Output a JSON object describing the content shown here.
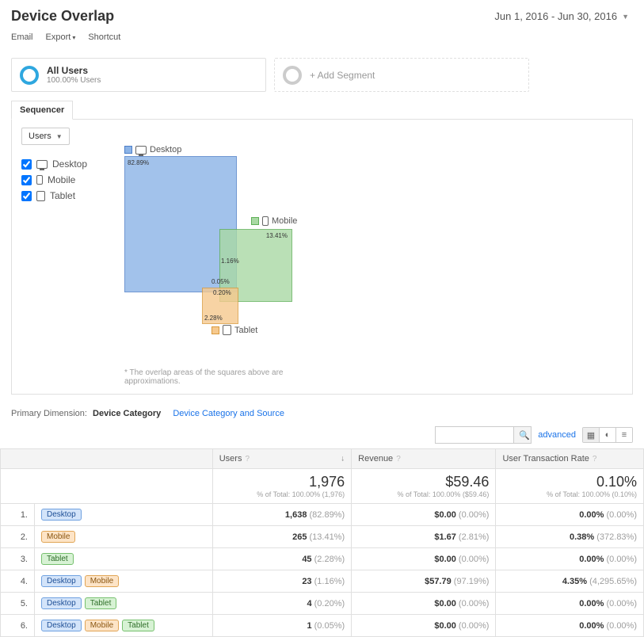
{
  "header": {
    "page_title": "Device Overlap",
    "date_range": "Jun 1, 2016 - Jun 30, 2016"
  },
  "toolbar": {
    "email": "Email",
    "export": "Export",
    "shortcut": "Shortcut"
  },
  "segments": {
    "all_users_title": "All Users",
    "all_users_sub": "100.00% Users",
    "add_segment": "+ Add Segment"
  },
  "tabs": {
    "sequencer": "Sequencer"
  },
  "dropdown": {
    "users": "Users"
  },
  "legend": {
    "desktop": "Desktop",
    "mobile": "Mobile",
    "tablet": "Tablet"
  },
  "venn": {
    "desktop_label": "Desktop",
    "mobile_label": "Mobile",
    "tablet_label": "Tablet",
    "pct_desktop": "82.89%",
    "pct_mobile": "13.41%",
    "pct_dm": "1.16%",
    "pct_dt": "0.20%",
    "pct_dmt": "0.05%",
    "pct_tablet": "2.28%",
    "footnote": "* The overlap areas of the squares above are approximations."
  },
  "prim_dim": {
    "label": "Primary Dimension:",
    "active": "Device Category",
    "other": "Device Category and Source"
  },
  "controls": {
    "advanced": "advanced",
    "search_placeholder": ""
  },
  "table": {
    "cols": {
      "cat": "",
      "users": "Users",
      "revenue": "Revenue",
      "utr": "User Transaction Rate"
    },
    "totals": {
      "users_val": "1,976",
      "users_sub": "% of Total: 100.00% (1,976)",
      "rev_val": "$59.46",
      "rev_sub": "% of Total: 100.00% ($59.46)",
      "utr_val": "0.10%",
      "utr_sub": "% of Total: 100.00% (0.10%)"
    },
    "rows": [
      {
        "idx": "1.",
        "chips": [
          "desktop"
        ],
        "labels": {
          "desktop": "Desktop"
        },
        "users": "1,638",
        "users_p": "(82.89%)",
        "rev": "$0.00",
        "rev_p": "(0.00%)",
        "utr": "0.00%",
        "utr_p": "(0.00%)"
      },
      {
        "idx": "2.",
        "chips": [
          "mobile"
        ],
        "labels": {
          "mobile": "Mobile"
        },
        "users": "265",
        "users_p": "(13.41%)",
        "rev": "$1.67",
        "rev_p": "(2.81%)",
        "utr": "0.38%",
        "utr_p": "(372.83%)"
      },
      {
        "idx": "3.",
        "chips": [
          "tablet"
        ],
        "labels": {
          "tablet": "Tablet"
        },
        "users": "45",
        "users_p": "(2.28%)",
        "rev": "$0.00",
        "rev_p": "(0.00%)",
        "utr": "0.00%",
        "utr_p": "(0.00%)"
      },
      {
        "idx": "4.",
        "chips": [
          "desktop",
          "mobile"
        ],
        "labels": {
          "desktop": "Desktop",
          "mobile": "Mobile"
        },
        "users": "23",
        "users_p": "(1.16%)",
        "rev": "$57.79",
        "rev_p": "(97.19%)",
        "utr": "4.35%",
        "utr_p": "(4,295.65%)"
      },
      {
        "idx": "5.",
        "chips": [
          "desktop",
          "tablet"
        ],
        "labels": {
          "desktop": "Desktop",
          "tablet": "Tablet"
        },
        "users": "4",
        "users_p": "(0.20%)",
        "rev": "$0.00",
        "rev_p": "(0.00%)",
        "utr": "0.00%",
        "utr_p": "(0.00%)"
      },
      {
        "idx": "6.",
        "chips": [
          "desktop",
          "mobile",
          "tablet"
        ],
        "labels": {
          "desktop": "Desktop",
          "mobile": "Mobile",
          "tablet": "Tablet"
        },
        "users": "1",
        "users_p": "(0.05%)",
        "rev": "$0.00",
        "rev_p": "(0.00%)",
        "utr": "0.00%",
        "utr_p": "(0.00%)"
      }
    ]
  },
  "chart_data": {
    "type": "venn-squares",
    "title": "Device Overlap — Users",
    "unit": "Users",
    "total_users": 1976,
    "sets": [
      {
        "name": "Desktop",
        "value": 1638,
        "percent": 82.89
      },
      {
        "name": "Mobile",
        "value": 265,
        "percent": 13.41
      },
      {
        "name": "Tablet",
        "value": 45,
        "percent": 2.28
      }
    ],
    "intersections": [
      {
        "sets": [
          "Desktop",
          "Mobile"
        ],
        "value": 23,
        "percent": 1.16
      },
      {
        "sets": [
          "Desktop",
          "Tablet"
        ],
        "value": 4,
        "percent": 0.2
      },
      {
        "sets": [
          "Desktop",
          "Mobile",
          "Tablet"
        ],
        "value": 1,
        "percent": 0.05
      }
    ],
    "note": "overlap areas are approximations"
  }
}
